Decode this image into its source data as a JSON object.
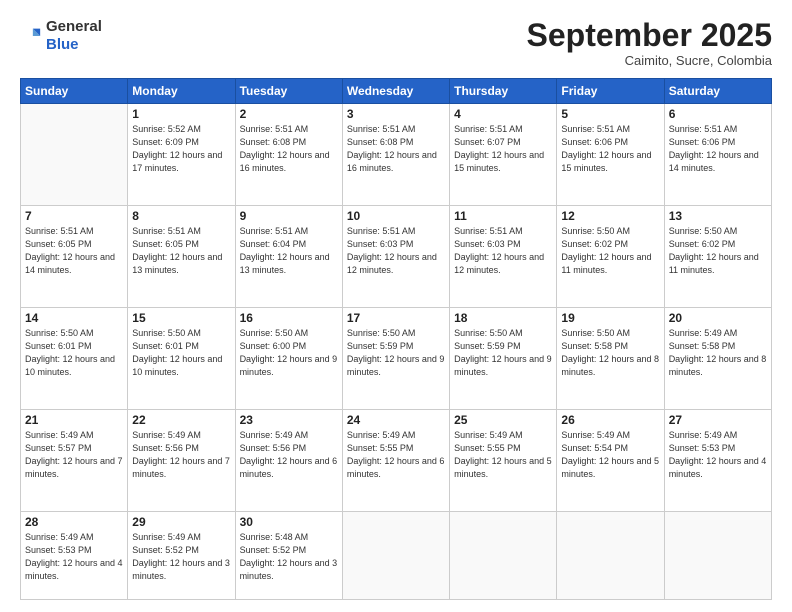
{
  "header": {
    "logo_line1": "General",
    "logo_line2": "Blue",
    "month_title": "September 2025",
    "subtitle": "Caimito, Sucre, Colombia"
  },
  "weekdays": [
    "Sunday",
    "Monday",
    "Tuesday",
    "Wednesday",
    "Thursday",
    "Friday",
    "Saturday"
  ],
  "weeks": [
    [
      {
        "day": "",
        "info": ""
      },
      {
        "day": "1",
        "info": "Sunrise: 5:52 AM\nSunset: 6:09 PM\nDaylight: 12 hours\nand 17 minutes."
      },
      {
        "day": "2",
        "info": "Sunrise: 5:51 AM\nSunset: 6:08 PM\nDaylight: 12 hours\nand 16 minutes."
      },
      {
        "day": "3",
        "info": "Sunrise: 5:51 AM\nSunset: 6:08 PM\nDaylight: 12 hours\nand 16 minutes."
      },
      {
        "day": "4",
        "info": "Sunrise: 5:51 AM\nSunset: 6:07 PM\nDaylight: 12 hours\nand 15 minutes."
      },
      {
        "day": "5",
        "info": "Sunrise: 5:51 AM\nSunset: 6:06 PM\nDaylight: 12 hours\nand 15 minutes."
      },
      {
        "day": "6",
        "info": "Sunrise: 5:51 AM\nSunset: 6:06 PM\nDaylight: 12 hours\nand 14 minutes."
      }
    ],
    [
      {
        "day": "7",
        "info": "Sunrise: 5:51 AM\nSunset: 6:05 PM\nDaylight: 12 hours\nand 14 minutes."
      },
      {
        "day": "8",
        "info": "Sunrise: 5:51 AM\nSunset: 6:05 PM\nDaylight: 12 hours\nand 13 minutes."
      },
      {
        "day": "9",
        "info": "Sunrise: 5:51 AM\nSunset: 6:04 PM\nDaylight: 12 hours\nand 13 minutes."
      },
      {
        "day": "10",
        "info": "Sunrise: 5:51 AM\nSunset: 6:03 PM\nDaylight: 12 hours\nand 12 minutes."
      },
      {
        "day": "11",
        "info": "Sunrise: 5:51 AM\nSunset: 6:03 PM\nDaylight: 12 hours\nand 12 minutes."
      },
      {
        "day": "12",
        "info": "Sunrise: 5:50 AM\nSunset: 6:02 PM\nDaylight: 12 hours\nand 11 minutes."
      },
      {
        "day": "13",
        "info": "Sunrise: 5:50 AM\nSunset: 6:02 PM\nDaylight: 12 hours\nand 11 minutes."
      }
    ],
    [
      {
        "day": "14",
        "info": "Sunrise: 5:50 AM\nSunset: 6:01 PM\nDaylight: 12 hours\nand 10 minutes."
      },
      {
        "day": "15",
        "info": "Sunrise: 5:50 AM\nSunset: 6:01 PM\nDaylight: 12 hours\nand 10 minutes."
      },
      {
        "day": "16",
        "info": "Sunrise: 5:50 AM\nSunset: 6:00 PM\nDaylight: 12 hours\nand 9 minutes."
      },
      {
        "day": "17",
        "info": "Sunrise: 5:50 AM\nSunset: 5:59 PM\nDaylight: 12 hours\nand 9 minutes."
      },
      {
        "day": "18",
        "info": "Sunrise: 5:50 AM\nSunset: 5:59 PM\nDaylight: 12 hours\nand 9 minutes."
      },
      {
        "day": "19",
        "info": "Sunrise: 5:50 AM\nSunset: 5:58 PM\nDaylight: 12 hours\nand 8 minutes."
      },
      {
        "day": "20",
        "info": "Sunrise: 5:49 AM\nSunset: 5:58 PM\nDaylight: 12 hours\nand 8 minutes."
      }
    ],
    [
      {
        "day": "21",
        "info": "Sunrise: 5:49 AM\nSunset: 5:57 PM\nDaylight: 12 hours\nand 7 minutes."
      },
      {
        "day": "22",
        "info": "Sunrise: 5:49 AM\nSunset: 5:56 PM\nDaylight: 12 hours\nand 7 minutes."
      },
      {
        "day": "23",
        "info": "Sunrise: 5:49 AM\nSunset: 5:56 PM\nDaylight: 12 hours\nand 6 minutes."
      },
      {
        "day": "24",
        "info": "Sunrise: 5:49 AM\nSunset: 5:55 PM\nDaylight: 12 hours\nand 6 minutes."
      },
      {
        "day": "25",
        "info": "Sunrise: 5:49 AM\nSunset: 5:55 PM\nDaylight: 12 hours\nand 5 minutes."
      },
      {
        "day": "26",
        "info": "Sunrise: 5:49 AM\nSunset: 5:54 PM\nDaylight: 12 hours\nand 5 minutes."
      },
      {
        "day": "27",
        "info": "Sunrise: 5:49 AM\nSunset: 5:53 PM\nDaylight: 12 hours\nand 4 minutes."
      }
    ],
    [
      {
        "day": "28",
        "info": "Sunrise: 5:49 AM\nSunset: 5:53 PM\nDaylight: 12 hours\nand 4 minutes."
      },
      {
        "day": "29",
        "info": "Sunrise: 5:49 AM\nSunset: 5:52 PM\nDaylight: 12 hours\nand 3 minutes."
      },
      {
        "day": "30",
        "info": "Sunrise: 5:48 AM\nSunset: 5:52 PM\nDaylight: 12 hours\nand 3 minutes."
      },
      {
        "day": "",
        "info": ""
      },
      {
        "day": "",
        "info": ""
      },
      {
        "day": "",
        "info": ""
      },
      {
        "day": "",
        "info": ""
      }
    ]
  ]
}
